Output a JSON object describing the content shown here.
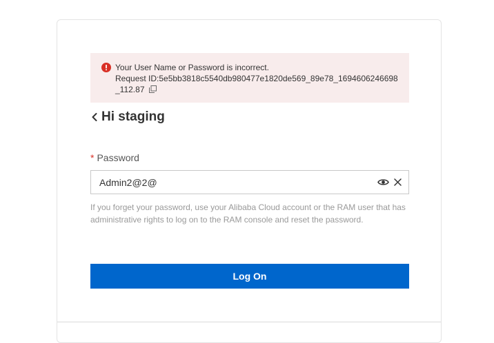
{
  "alert": {
    "message": "Your User Name or Password is incorrect.",
    "request_id": "Request ID:5e5bb3818c5540db980477e1820de569_89e78_1694606246698_112.87",
    "icon": "error-icon",
    "copy_icon": "copy-icon",
    "color": "#d93026",
    "background": "#f8ecec"
  },
  "heading": {
    "back_icon": "chevron-left-icon",
    "title": "Hi staging"
  },
  "password": {
    "required_mark": "*",
    "label": "Password",
    "value": "Admin2@2@",
    "show_icon": "eye-icon",
    "clear_icon": "close-icon"
  },
  "hint": "If you forget your password, use your Alibaba Cloud account or the RAM user that has administrative rights to log on to the RAM console and reset the password.",
  "login_button": {
    "label": "Log On",
    "color": "#0066cc"
  }
}
